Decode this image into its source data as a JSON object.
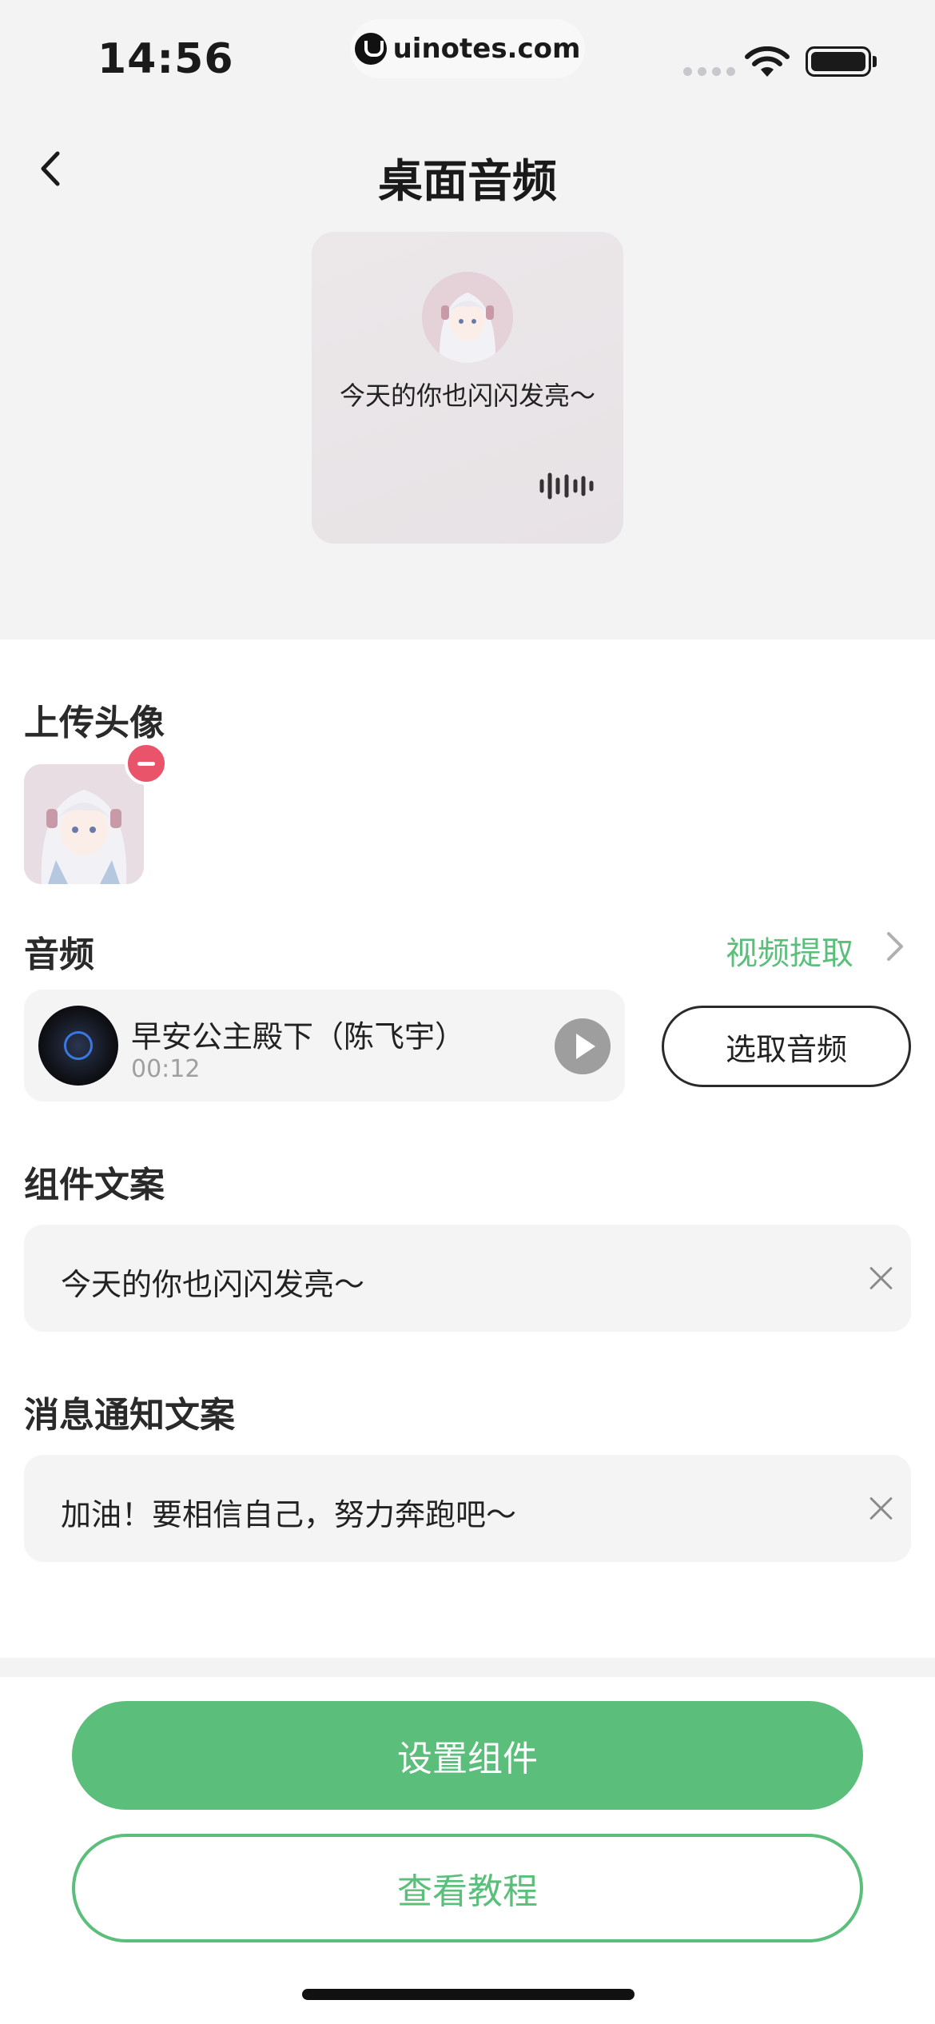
{
  "status_bar": {
    "time": "14:56",
    "url": "uinotes.com"
  },
  "header": {
    "title": "桌面音频"
  },
  "widget_preview": {
    "text": "今天的你也闪闪发亮～"
  },
  "avatar_section": {
    "label": "上传头像"
  },
  "audio_section": {
    "label": "音频",
    "video_extract": "视频提取",
    "track_title": "早安公主殿下（陈飞宇）",
    "track_duration": "00:12",
    "pick_label": "选取音频"
  },
  "widget_text_section": {
    "label": "组件文案",
    "value": "今天的你也闪闪发亮～"
  },
  "notify_text_section": {
    "label": "消息通知文案",
    "value": "加油！要相信自己，努力奔跑吧～"
  },
  "actions": {
    "primary": "设置组件",
    "secondary": "查看教程"
  },
  "colors": {
    "accent": "#5bbf7b",
    "danger": "#e9546b",
    "panel": "#f4f4f4"
  }
}
